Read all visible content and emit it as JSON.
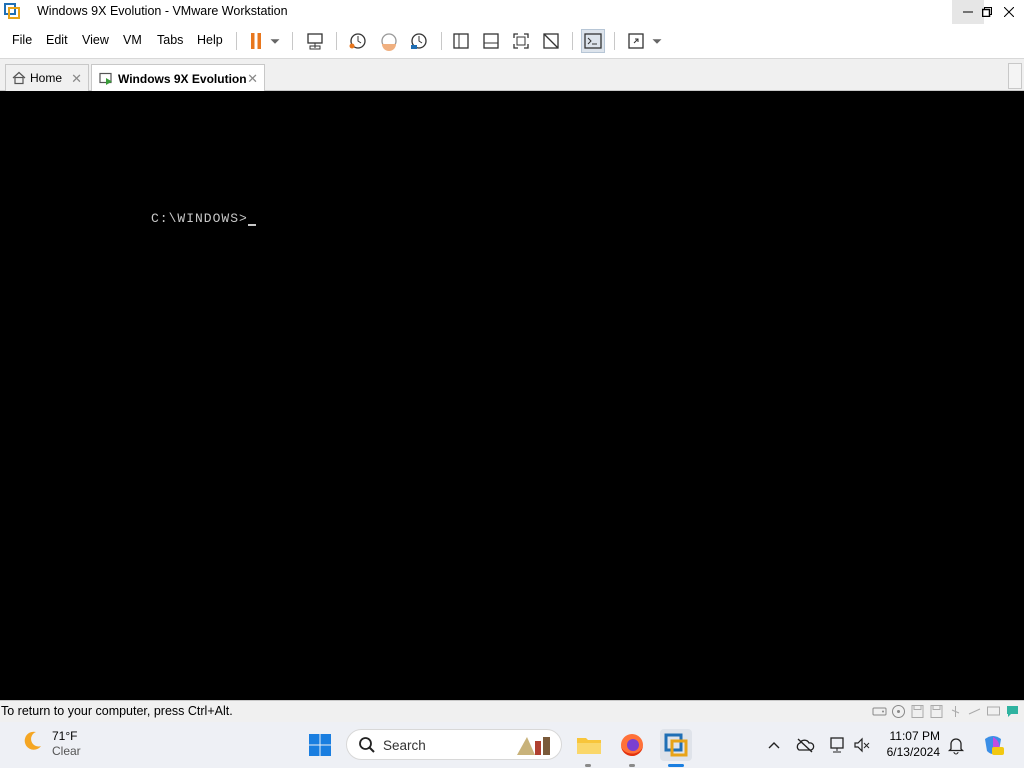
{
  "window": {
    "title": "Windows 9X Evolution - VMware Workstation"
  },
  "menu": {
    "items": [
      "File",
      "Edit",
      "View",
      "VM",
      "Tabs",
      "Help"
    ]
  },
  "tabs": [
    {
      "label": "Home"
    },
    {
      "label": "Windows 9X Evolution"
    }
  ],
  "console": {
    "prompt": "C:\\WINDOWS>"
  },
  "status": {
    "message": "To return to your computer, press Ctrl+Alt."
  },
  "taskbar": {
    "weather": {
      "temp": "71°F",
      "condition": "Clear"
    },
    "search_label": "Search",
    "time": "11:07 PM",
    "date": "6/13/2024"
  },
  "colors": {
    "accent_orange": "#e8771e",
    "vmware_blue": "#1f6fb5",
    "console_bg": "#000000"
  }
}
